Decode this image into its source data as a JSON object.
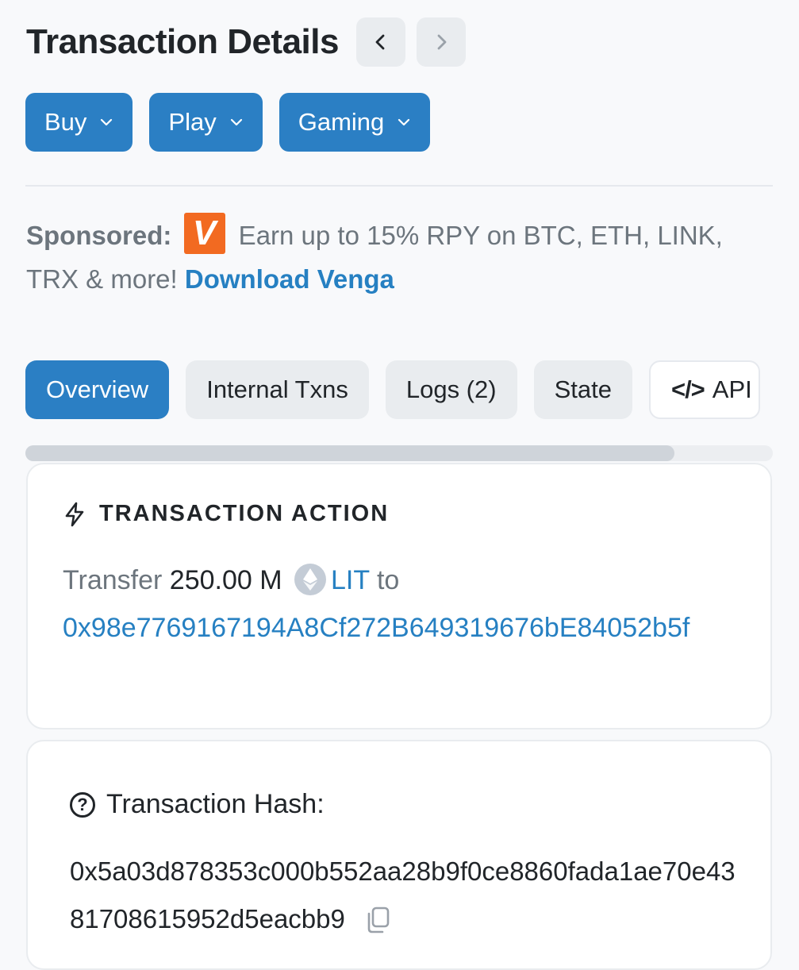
{
  "header": {
    "title": "Transaction Details",
    "prev_icon": "chevron-left-icon",
    "next_icon": "chevron-right-icon"
  },
  "menu": [
    {
      "label": "Buy"
    },
    {
      "label": "Play"
    },
    {
      "label": "Gaming"
    }
  ],
  "sponsor": {
    "label": "Sponsored:",
    "logo_letter": "V",
    "text": " Earn up to 15% RPY on BTC, ETH, LINK, TRX & more! ",
    "link": "Download Venga",
    "logo_color": "#f26a21"
  },
  "tabs": [
    {
      "label": "Overview",
      "active": true
    },
    {
      "label": "Internal Txns"
    },
    {
      "label": "Logs (2)"
    },
    {
      "label": "State"
    },
    {
      "label": "API",
      "icon": "code-icon"
    }
  ],
  "action": {
    "title": "TRANSACTION ACTION",
    "verb": "Transfer",
    "amount": "250.00 M",
    "token": "LIT",
    "to_word": "to",
    "address": "0x98e7769167194A8Cf272B649319676bE84052b5f"
  },
  "hash": {
    "label": "Transaction Hash:",
    "value": "0x5a03d878353c000b552aa28b9f0ce8860fada1ae70e4381708615952d5eacbb9"
  },
  "colors": {
    "accent": "#2b7fc4",
    "link": "#2680c2"
  }
}
